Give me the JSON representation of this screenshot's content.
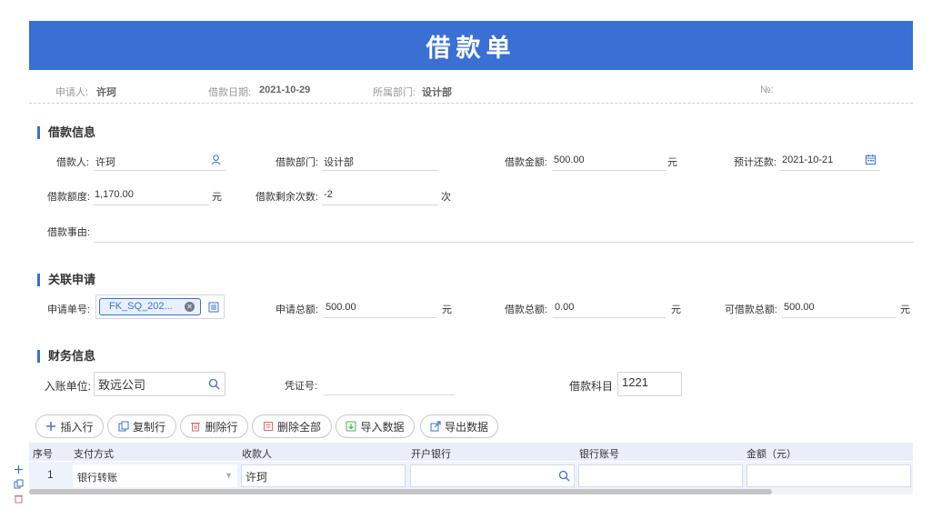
{
  "title": "借款单",
  "meta": {
    "applicant_label": "申请人:",
    "applicant_value": "许珂",
    "date_label": "借款日期:",
    "date_value": "2021-10-29",
    "dept_label": "所属部门:",
    "dept_value": "设计部",
    "no_label": "№:"
  },
  "loan_section": {
    "title": "借款信息",
    "borrower_label": "借款人:",
    "borrower_value": "许珂",
    "dept_label": "借款部门:",
    "dept_value": "设计部",
    "amount_label": "借款金额:",
    "amount_value": "500.00",
    "amount_unit": "元",
    "repay_label": "预计还款:",
    "repay_value": "2021-10-21",
    "limit_label": "借款额度:",
    "limit_value": "1,170.00",
    "limit_unit": "元",
    "remaining_label": "借款剩余次数:",
    "remaining_value": "-2",
    "remaining_unit": "次",
    "reason_label": "借款事由:",
    "reason_value": ""
  },
  "related_section": {
    "title": "关联申请",
    "app_no_label": "申请单号:",
    "app_no_tag": "FK_SQ_202...",
    "total_label": "申请总额:",
    "total_value": "500.00",
    "total_unit": "元",
    "loan_total_label": "借款总额:",
    "loan_total_value": "0.00",
    "loan_total_unit": "元",
    "available_label": "可借款总额:",
    "available_value": "500.00",
    "available_unit": "元"
  },
  "finance_section": {
    "title": "财务信息",
    "unit_label": "入账单位:",
    "unit_value": "致远公司",
    "voucher_label": "凭证号:",
    "voucher_value": "",
    "subject_label": "借款科目",
    "subject_value": "1221"
  },
  "toolbar": {
    "insert": "插入行",
    "copy": "复制行",
    "delete": "删除行",
    "delete_all": "删除全部",
    "import": "导入数据",
    "export": "导出数据"
  },
  "table": {
    "headers": [
      "序号",
      "支付方式",
      "收款人",
      "开户银行",
      "银行账号",
      "金额（元）"
    ],
    "rows": [
      {
        "index": "1",
        "payment_method": "银行转账",
        "payee": "许珂",
        "bank": "",
        "account": "",
        "amount": ""
      }
    ]
  },
  "side_icons": [
    "plus-icon",
    "copy-icon",
    "trash-icon"
  ],
  "colors": {
    "accent": "#3a6fd3",
    "table_header": "#e9eef8"
  }
}
